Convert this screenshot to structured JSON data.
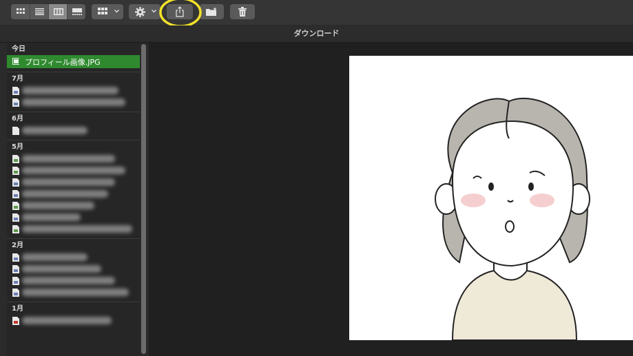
{
  "toolbar": {
    "view_buttons": [
      "icon-view",
      "list-view",
      "column-view",
      "gallery-view"
    ],
    "active_view": "column-view",
    "group_button": "group-by",
    "action_button": "action-gear",
    "share_button": "share",
    "new_folder_button": "new-folder",
    "trash_button": "trash"
  },
  "window": {
    "title": "ダウンロード"
  },
  "sidebar": {
    "groups": [
      {
        "label": "今日",
        "items": [
          {
            "name": "プロフィール画像.JPG",
            "selected": true
          }
        ]
      },
      {
        "label": "7月",
        "items": [
          {},
          {}
        ]
      },
      {
        "label": "6月",
        "items": [
          {}
        ]
      },
      {
        "label": "5月",
        "items": [
          {},
          {},
          {},
          {},
          {},
          {},
          {}
        ]
      },
      {
        "label": "2月",
        "items": [
          {},
          {},
          {},
          {}
        ]
      },
      {
        "label": "1月",
        "items": [
          {}
        ]
      }
    ]
  },
  "colors": {
    "selection": "#2f8a2f",
    "highlight_circle": "#f2e12a"
  }
}
